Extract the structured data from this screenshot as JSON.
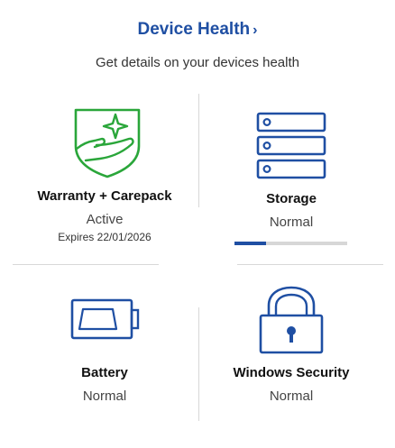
{
  "header": {
    "title": "Device Health",
    "chevron": "›",
    "subtitle": "Get details on your devices health"
  },
  "cards": {
    "warranty": {
      "title": "Warranty + Carepack",
      "status": "Active",
      "expiry": "Expires 22/01/2026",
      "icon": "shield-hand-sparkle-icon",
      "color": "#2aa63a"
    },
    "storage": {
      "title": "Storage",
      "status": "Normal",
      "icon": "storage-drives-icon",
      "usage_fraction": 0.28
    },
    "battery": {
      "title": "Battery",
      "status": "Normal",
      "icon": "battery-icon"
    },
    "security": {
      "title": "Windows Security",
      "status": "Normal",
      "icon": "padlock-icon"
    }
  },
  "colors": {
    "accent": "#1f4fa3",
    "green": "#2aa63a",
    "divider": "#d8d8d8",
    "track": "#d7d7d7"
  }
}
